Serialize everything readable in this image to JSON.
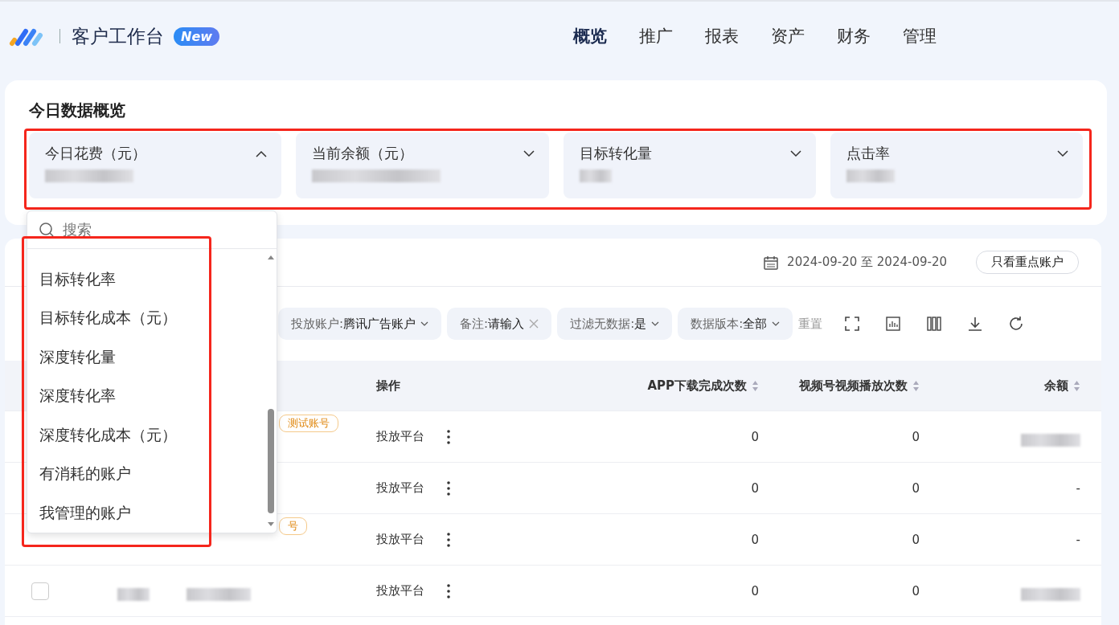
{
  "header": {
    "title": "客户工作台",
    "badge": "New",
    "nav": [
      {
        "label": "概览",
        "selected": true
      },
      {
        "label": "推广",
        "selected": false
      },
      {
        "label": "报表",
        "selected": false
      },
      {
        "label": "资产",
        "selected": false
      },
      {
        "label": "财务",
        "selected": false
      },
      {
        "label": "管理",
        "selected": false
      }
    ]
  },
  "overview": {
    "title": "今日数据概览",
    "metrics": [
      {
        "label": "今日花费（元）",
        "expanded": true
      },
      {
        "label": "当前余额（元）",
        "expanded": false
      },
      {
        "label": "目标转化量",
        "expanded": false
      },
      {
        "label": "点击率",
        "expanded": false
      }
    ]
  },
  "dropdown": {
    "search_placeholder": "搜索",
    "options": [
      "目标转化率",
      "目标转化成本（元）",
      "深度转化量",
      "深度转化率",
      "深度转化成本（元）",
      "有消耗的账户",
      "我管理的账户"
    ]
  },
  "toolbar": {
    "date_range": "2024-09-20 至 2024-09-20",
    "key_accounts_button": "只看重点账户"
  },
  "filters": [
    {
      "kind": "select",
      "label": "投放账户:",
      "value": "腾讯广告账户"
    },
    {
      "kind": "input",
      "label": "备注:",
      "value": "请输入"
    },
    {
      "kind": "select",
      "label": "过滤无数据:",
      "value": "是"
    },
    {
      "kind": "select",
      "label": "数据版本:",
      "value": "全部"
    }
  ],
  "reset": "重置",
  "table": {
    "columns": [
      {
        "label": "操作",
        "sortable": false
      },
      {
        "label": "APP下载完成次数",
        "sortable": true
      },
      {
        "label": "视频号视频播放次数",
        "sortable": true
      },
      {
        "label": "余额",
        "sortable": true
      }
    ],
    "rows": [
      {
        "tag": "测试账号",
        "action": "投放平台",
        "app_downloads": "0",
        "video_plays": "0",
        "balance": null
      },
      {
        "action": "投放平台",
        "app_downloads": "0",
        "video_plays": "0",
        "balance": "-"
      },
      {
        "tag": "号",
        "action": "投放平台",
        "app_downloads": "0",
        "video_plays": "0",
        "balance": "-"
      },
      {
        "checked": false,
        "action": "投放平台",
        "app_downloads": "0",
        "video_plays": "0",
        "balance": null
      }
    ]
  }
}
